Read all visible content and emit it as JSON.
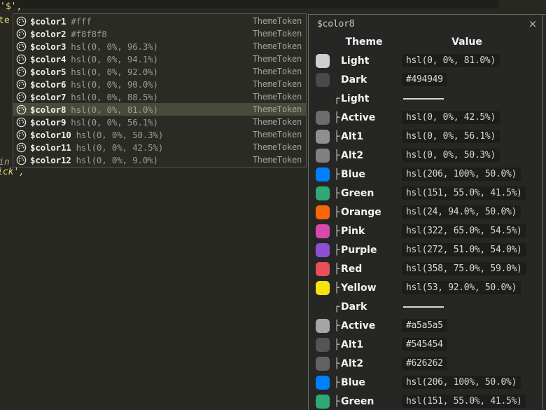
{
  "editor": {
    "code_top": "'$',",
    "code_left_a": "te",
    "code_left_b": "in",
    "code_left_c": "ick',"
  },
  "autocomplete": {
    "icon_name": "palette-icon",
    "items": [
      {
        "name": "$color1",
        "value": "#fff",
        "kind": "ThemeToken",
        "selected": false
      },
      {
        "name": "$color2",
        "value": "#f8f8f8",
        "kind": "ThemeToken",
        "selected": false
      },
      {
        "name": "$color3",
        "value": "hsl(0, 0%, 96.3%)",
        "kind": "ThemeToken",
        "selected": false
      },
      {
        "name": "$color4",
        "value": "hsl(0, 0%, 94.1%)",
        "kind": "ThemeToken",
        "selected": false
      },
      {
        "name": "$color5",
        "value": "hsl(0, 0%, 92.0%)",
        "kind": "ThemeToken",
        "selected": false
      },
      {
        "name": "$color6",
        "value": "hsl(0, 0%, 90.0%)",
        "kind": "ThemeToken",
        "selected": false
      },
      {
        "name": "$color7",
        "value": "hsl(0, 0%, 88.5%)",
        "kind": "ThemeToken",
        "selected": false
      },
      {
        "name": "$color8",
        "value": "hsl(0, 0%, 81.0%)",
        "kind": "ThemeToken",
        "selected": true
      },
      {
        "name": "$color9",
        "value": "hsl(0, 0%, 56.1%)",
        "kind": "ThemeToken",
        "selected": false
      },
      {
        "name": "$color10",
        "value": "hsl(0, 0%, 50.3%)",
        "kind": "ThemeToken",
        "selected": false
      },
      {
        "name": "$color11",
        "value": "hsl(0, 0%, 42.5%)",
        "kind": "ThemeToken",
        "selected": false
      },
      {
        "name": "$color12",
        "value": "hsl(0, 0%, 9.0%)",
        "kind": "ThemeToken",
        "selected": false
      }
    ]
  },
  "panel": {
    "title": "$color8",
    "close_label": "×",
    "columns": {
      "theme": "Theme",
      "value": "Value"
    },
    "rows": [
      {
        "label": "Light",
        "value": "hsl(0, 0%, 81.0%)",
        "swatch": "#cecece",
        "branch": "",
        "type": "item"
      },
      {
        "label": "Dark",
        "value": "#494949",
        "swatch": "#494949",
        "branch": "",
        "type": "item"
      },
      {
        "label": "Light",
        "value": "",
        "swatch": "",
        "branch": "┌",
        "type": "group"
      },
      {
        "label": "Active",
        "value": "hsl(0, 0%, 42.5%)",
        "swatch": "#6c6c6c",
        "branch": "├",
        "type": "item"
      },
      {
        "label": "Alt1",
        "value": "hsl(0, 0%, 56.1%)",
        "swatch": "#8f8f8f",
        "branch": "├",
        "type": "item"
      },
      {
        "label": "Alt2",
        "value": "hsl(0, 0%, 50.3%)",
        "swatch": "#808080",
        "branch": "├",
        "type": "item"
      },
      {
        "label": "Blue",
        "value": "hsl(206, 100%, 50.0%)",
        "swatch": "#0080ff",
        "branch": "├",
        "type": "item"
      },
      {
        "label": "Green",
        "value": "hsl(151, 55.0%, 41.5%)",
        "swatch": "#30a875",
        "branch": "├",
        "type": "item"
      },
      {
        "label": "Orange",
        "value": "hsl(24, 94.0%, 50.0%)",
        "swatch": "#f76707",
        "branch": "├",
        "type": "item"
      },
      {
        "label": "Pink",
        "value": "hsl(322, 65.0%, 54.5%)",
        "swatch": "#d849ab",
        "branch": "├",
        "type": "item"
      },
      {
        "label": "Purple",
        "value": "hsl(272, 51.0%, 54.0%)",
        "swatch": "#8d4fd4",
        "branch": "├",
        "type": "item"
      },
      {
        "label": "Red",
        "value": "hsl(358, 75.0%, 59.0%)",
        "swatch": "#e9505a",
        "branch": "├",
        "type": "item"
      },
      {
        "label": "Yellow",
        "value": "hsl(53, 92.0%, 50.0%)",
        "swatch": "#f5e40a",
        "branch": "├",
        "type": "item"
      },
      {
        "label": "Dark",
        "value": "",
        "swatch": "",
        "branch": "┌",
        "type": "group"
      },
      {
        "label": "Active",
        "value": "#a5a5a5",
        "swatch": "#a5a5a5",
        "branch": "├",
        "type": "item"
      },
      {
        "label": "Alt1",
        "value": "#545454",
        "swatch": "#545454",
        "branch": "├",
        "type": "item"
      },
      {
        "label": "Alt2",
        "value": "#626262",
        "swatch": "#626262",
        "branch": "├",
        "type": "item"
      },
      {
        "label": "Blue",
        "value": "hsl(206, 100%, 50.0%)",
        "swatch": "#0080ff",
        "branch": "├",
        "type": "item"
      },
      {
        "label": "Green",
        "value": "hsl(151, 55.0%, 41.5%)",
        "swatch": "#30a875",
        "branch": "├",
        "type": "item"
      }
    ]
  }
}
